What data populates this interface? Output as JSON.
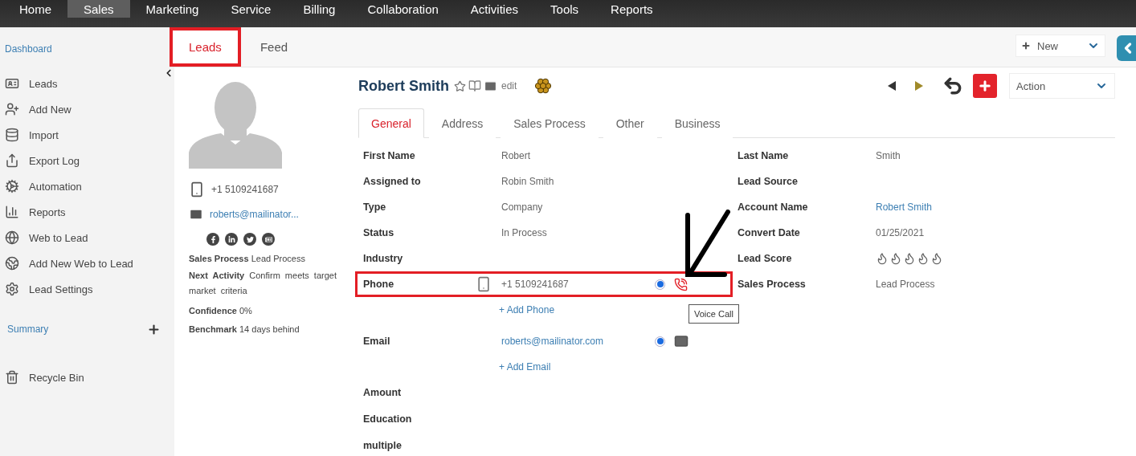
{
  "nav": [
    {
      "label": "Home",
      "selected": false
    },
    {
      "label": "Sales",
      "selected": true
    },
    {
      "label": "Marketing",
      "selected": false
    },
    {
      "label": "Service",
      "selected": false
    },
    {
      "label": "Billing",
      "selected": false
    },
    {
      "label": "Collaboration",
      "selected": false
    },
    {
      "label": "Activities",
      "selected": false
    },
    {
      "label": "Tools",
      "selected": false
    },
    {
      "label": "Reports",
      "selected": false
    }
  ],
  "sidebar": {
    "dashboard": "Dashboard",
    "items": [
      {
        "label": "Leads"
      },
      {
        "label": "Add New"
      },
      {
        "label": "Import"
      },
      {
        "label": "Export Log"
      },
      {
        "label": "Automation"
      },
      {
        "label": "Reports"
      },
      {
        "label": "Web to Lead"
      },
      {
        "label": "Add New Web to Lead"
      },
      {
        "label": "Lead Settings"
      }
    ],
    "summary": "Summary",
    "recycle": "Recycle Bin"
  },
  "page_tabs": [
    {
      "label": "Leads",
      "selected": true,
      "highlighted": true
    },
    {
      "label": "Feed",
      "selected": false,
      "highlighted": false
    }
  ],
  "new_button": "New",
  "profile": {
    "phone": "+1 5109241687",
    "email": "roberts@mailinator...",
    "sales_process_label": "Sales Process",
    "sales_process": "Lead Process",
    "next_activity_label": "Next Activity",
    "next_activity": "Confirm meets target market criteria",
    "confidence_label": "Confidence",
    "confidence": "0%",
    "benchmark_label": "Benchmark",
    "benchmark": "14 days behind"
  },
  "record": {
    "name": "Robert Smith",
    "edit": "edit",
    "action": "Action"
  },
  "record_tabs": [
    {
      "label": "General",
      "selected": true
    },
    {
      "label": "Address",
      "selected": false
    },
    {
      "label": "Sales Process",
      "selected": false
    },
    {
      "label": "Other",
      "selected": false
    },
    {
      "label": "Business",
      "selected": false
    }
  ],
  "left_fields": [
    {
      "kind": "text",
      "label": "First Name",
      "value": "Robert"
    },
    {
      "kind": "text",
      "label": "Assigned to",
      "value": "Robin Smith"
    },
    {
      "kind": "text",
      "label": "Type",
      "value": "Company"
    },
    {
      "kind": "text",
      "label": "Status",
      "value": "In Process"
    },
    {
      "kind": "text",
      "label": "Industry"
    },
    {
      "kind": "phone",
      "label": "Phone",
      "value": "+1 5109241687",
      "primary": true,
      "highlighted": true,
      "add": "+ Add Phone",
      "tooltip": "Voice Call"
    },
    {
      "kind": "email",
      "label": "Email",
      "value": "roberts@mailinator.com",
      "primary": true,
      "highlighted": false,
      "add": "+ Add Email"
    },
    {
      "kind": "text",
      "label": "Amount"
    },
    {
      "kind": "text",
      "label": "Education"
    },
    {
      "kind": "text",
      "label": "multiple"
    }
  ],
  "right_fields": [
    {
      "kind": "text",
      "label": "Last Name",
      "value": "Smith"
    },
    {
      "kind": "text",
      "label": "Lead Source"
    },
    {
      "kind": "link",
      "label": "Account Name",
      "value": "Robert Smith"
    },
    {
      "kind": "text",
      "label": "Convert Date",
      "value": "01/25/2021"
    },
    {
      "kind": "score",
      "label": "Lead Score"
    },
    {
      "kind": "text",
      "label": "Sales Process",
      "value": "Lead Process"
    }
  ]
}
